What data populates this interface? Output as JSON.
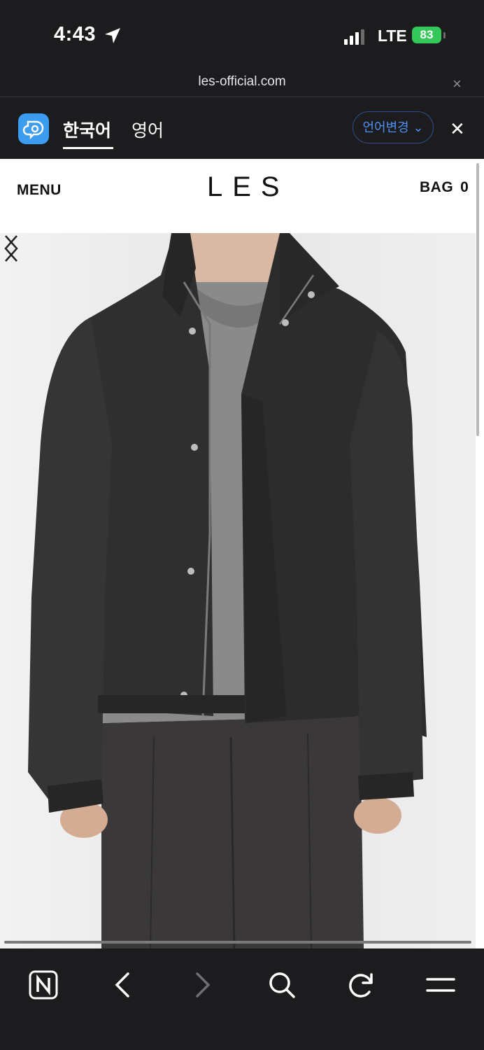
{
  "status_bar": {
    "time": "4:43",
    "network": "LTE",
    "battery": "83"
  },
  "browser": {
    "url": "les-official.com",
    "url_close_symbol": "×"
  },
  "translate_bar": {
    "lang_source": "한국어",
    "lang_target": "영어",
    "change_button": "언어변경 ⌄",
    "close_symbol": "✕"
  },
  "site": {
    "menu_label": "MENU",
    "logo": "LES",
    "bag_label": "BAG",
    "bag_count": "0"
  },
  "product_image": {
    "description_icon": "jacket-photo",
    "prev_icon": "chevron-left-icon",
    "next_icon": "chevron-right-icon"
  },
  "toolbar": {
    "items": [
      "naver-home-icon",
      "back-icon",
      "forward-icon",
      "search-icon",
      "reload-icon",
      "menu-icon"
    ]
  },
  "colors": {
    "battery_green": "#34c759",
    "link_blue": "#4e8ff0",
    "papago_blue": "#3b9cf0"
  }
}
